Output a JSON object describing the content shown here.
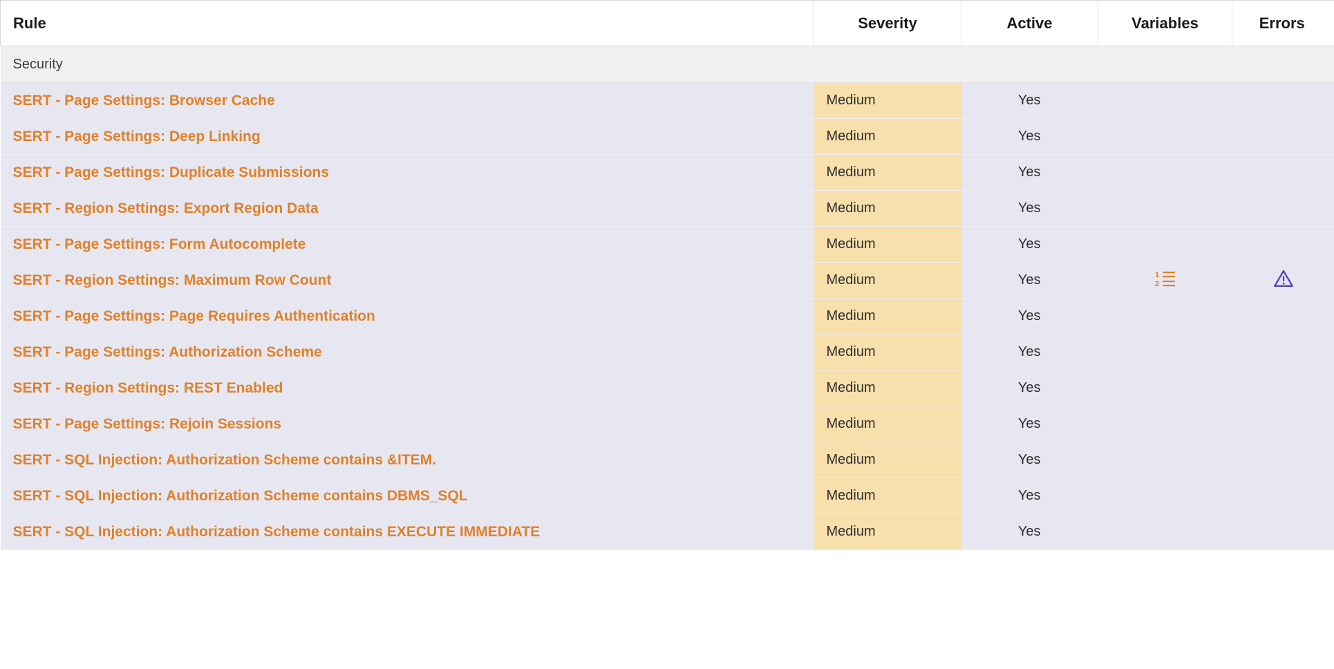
{
  "table": {
    "columns": [
      {
        "key": "rule",
        "label": "Rule",
        "align": "left"
      },
      {
        "key": "severity",
        "label": "Severity",
        "align": "center"
      },
      {
        "key": "active",
        "label": "Active",
        "align": "center"
      },
      {
        "key": "variables",
        "label": "Variables",
        "align": "center"
      },
      {
        "key": "errors",
        "label": "Errors",
        "align": "center"
      }
    ],
    "group_label": "Security",
    "rows": [
      {
        "rule": "SERT - Page Settings: Browser Cache",
        "severity": "Medium",
        "active": "Yes",
        "variables": "",
        "errors": ""
      },
      {
        "rule": "SERT - Page Settings: Deep Linking",
        "severity": "Medium",
        "active": "Yes",
        "variables": "",
        "errors": ""
      },
      {
        "rule": "SERT - Page Settings: Duplicate Submissions",
        "severity": "Medium",
        "active": "Yes",
        "variables": "",
        "errors": ""
      },
      {
        "rule": "SERT - Region Settings: Export Region Data",
        "severity": "Medium",
        "active": "Yes",
        "variables": "",
        "errors": ""
      },
      {
        "rule": "SERT - Page Settings: Form Autocomplete",
        "severity": "Medium",
        "active": "Yes",
        "variables": "",
        "errors": ""
      },
      {
        "rule": "SERT - Region Settings: Maximum Row Count",
        "severity": "Medium",
        "active": "Yes",
        "variables": "numbered-list-icon",
        "errors": "warning-triangle-icon"
      },
      {
        "rule": "SERT - Page Settings: Page Requires Authentication",
        "severity": "Medium",
        "active": "Yes",
        "variables": "",
        "errors": ""
      },
      {
        "rule": "SERT - Page Settings: Authorization Scheme",
        "severity": "Medium",
        "active": "Yes",
        "variables": "",
        "errors": ""
      },
      {
        "rule": "SERT - Region Settings: REST Enabled",
        "severity": "Medium",
        "active": "Yes",
        "variables": "",
        "errors": ""
      },
      {
        "rule": "SERT - Page Settings: Rejoin Sessions",
        "severity": "Medium",
        "active": "Yes",
        "variables": "",
        "errors": ""
      },
      {
        "rule": "SERT - SQL Injection: Authorization Scheme contains &ITEM.",
        "severity": "Medium",
        "active": "Yes",
        "variables": "",
        "errors": ""
      },
      {
        "rule": "SERT - SQL Injection: Authorization Scheme contains DBMS_SQL",
        "severity": "Medium",
        "active": "Yes",
        "variables": "",
        "errors": ""
      },
      {
        "rule": "SERT - SQL Injection: Authorization Scheme contains EXECUTE IMMEDIATE",
        "severity": "Medium",
        "active": "Yes",
        "variables": "",
        "errors": ""
      }
    ]
  },
  "colors": {
    "rule_link": "#e08128",
    "row_background": "#e7e7f2",
    "severity_background": "#f8e0ad",
    "group_background": "#f0f0f0",
    "header_background": "#ffffff",
    "variables_icon": "#e08128",
    "errors_icon": "#5b3fc4"
  }
}
